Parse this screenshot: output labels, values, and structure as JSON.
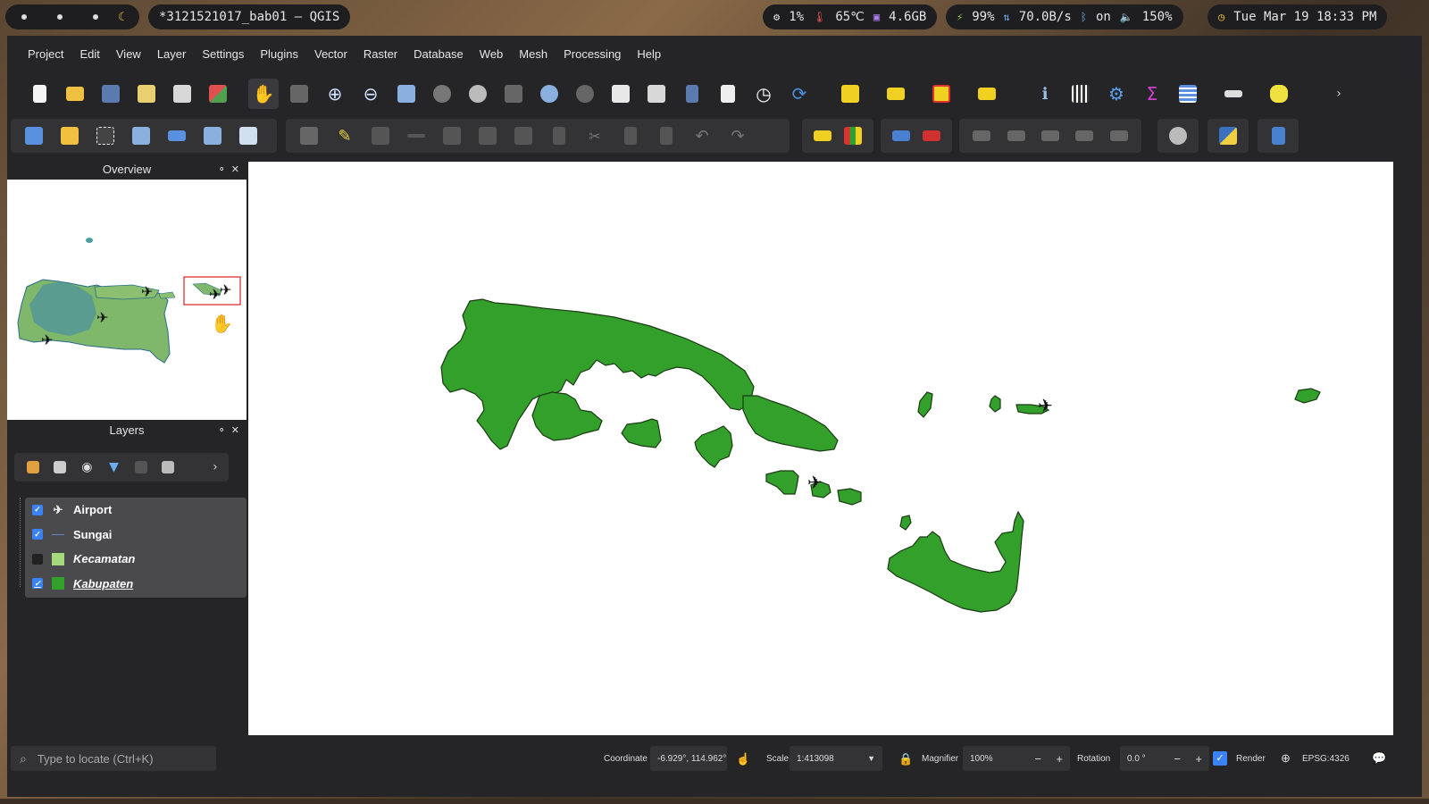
{
  "sysbar": {
    "window_title": "*3121521017_bab01 — QGIS",
    "cpu": "1%",
    "temp": "65℃",
    "mem": "4.6GB",
    "battery": "99%",
    "net": "70.0B/s",
    "bluetooth": "on",
    "volume": "150%",
    "datetime": "Tue Mar 19 18:33 PM"
  },
  "menu": [
    "Project",
    "Edit",
    "View",
    "Layer",
    "Settings",
    "Plugins",
    "Vector",
    "Raster",
    "Database",
    "Web",
    "Mesh",
    "Processing",
    "Help"
  ],
  "overview": {
    "title": "Overview"
  },
  "layers_panel": {
    "title": "Layers",
    "layers": [
      {
        "name": "Airport",
        "checked": true,
        "symbol": "airplane-icon"
      },
      {
        "name": "Sungai",
        "checked": true,
        "symbol": "line"
      },
      {
        "name": "Kecamatan",
        "checked": false,
        "symbol": "fill",
        "color": "#a6d97e"
      },
      {
        "name": "Kabupaten",
        "checked": true,
        "symbol": "fill",
        "color": "#33a02c"
      }
    ]
  },
  "map": {
    "fill_color": "#33a02c"
  },
  "statusbar": {
    "locator_placeholder": "Type to locate (Ctrl+K)",
    "coordinate_label": "Coordinate",
    "coordinate_value": "-6.929°, 114.962°",
    "scale_label": "Scale",
    "scale_value": "1:413098",
    "magnifier_label": "Magnifier",
    "magnifier_value": "100%",
    "rotation_label": "Rotation",
    "rotation_value": "0.0 °",
    "render_label": "Render",
    "crs": "EPSG:4326"
  }
}
